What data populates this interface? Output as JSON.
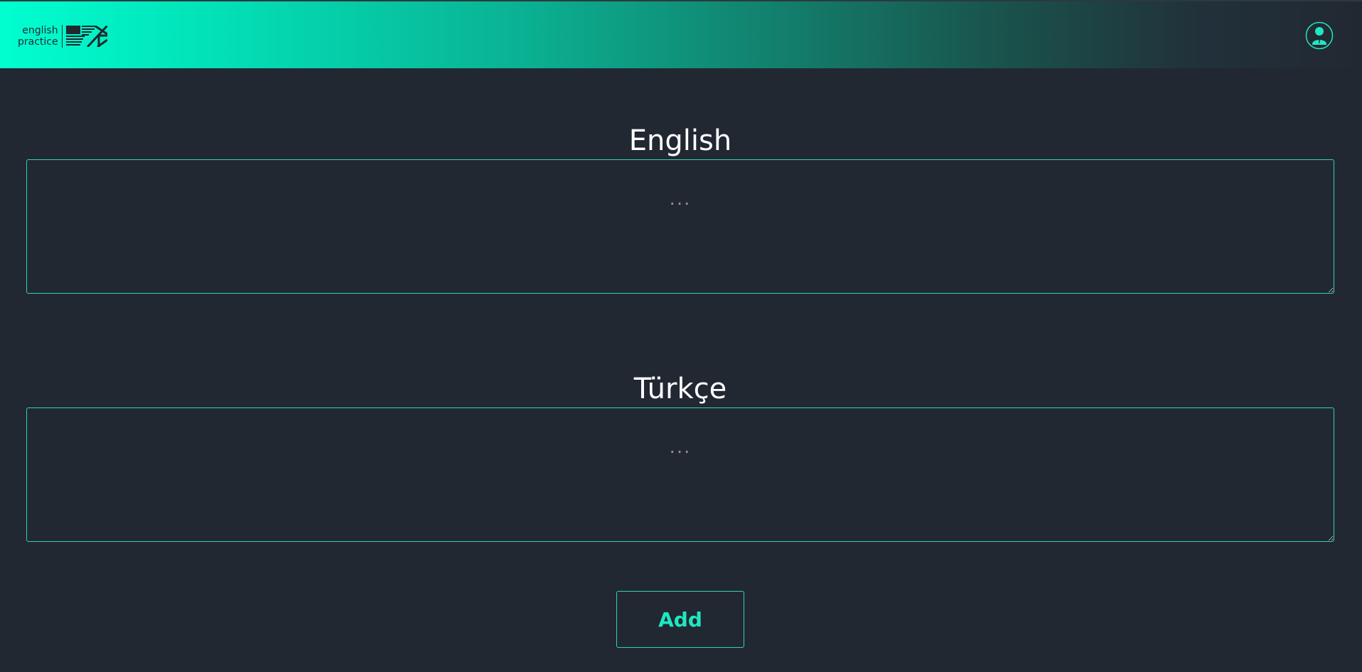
{
  "header": {
    "logo": {
      "line1": "english",
      "line2": "practice",
      "flag_icon": "us-uk-flag-icon"
    },
    "user_icon": "user-avatar-icon"
  },
  "form": {
    "english": {
      "label": "English",
      "placeholder": "...",
      "value": ""
    },
    "turkish": {
      "label": "Türkçe",
      "placeholder": "...",
      "value": ""
    },
    "add_label": "Add"
  },
  "colors": {
    "background": "#222832",
    "accent": "#1fe8c0",
    "header_gradient_start": "#00ffd0",
    "header_gradient_end": "#222832",
    "border": "#2fd3b2"
  }
}
